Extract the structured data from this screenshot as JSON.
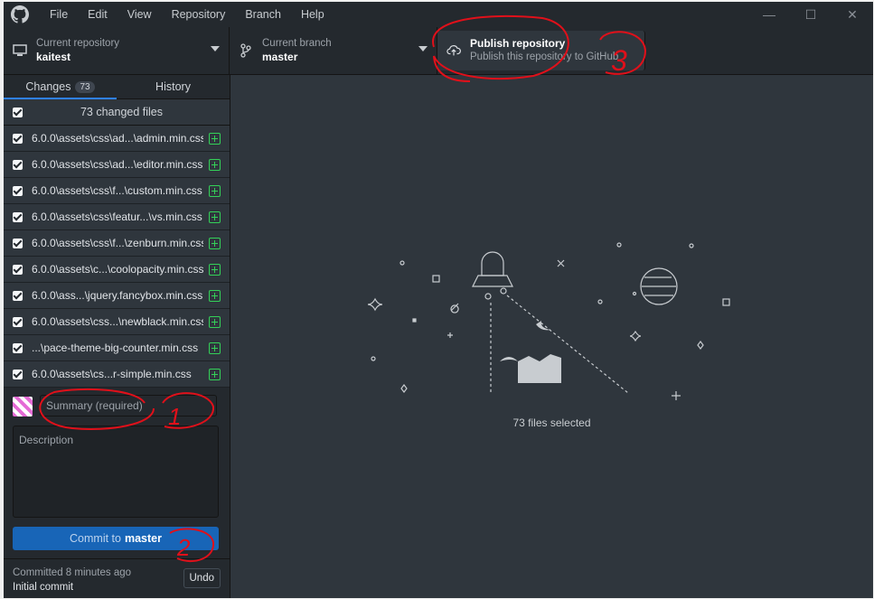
{
  "menu": [
    "File",
    "Edit",
    "View",
    "Repository",
    "Branch",
    "Help"
  ],
  "window_controls": {
    "minimize": "—",
    "maximize": "☐",
    "close": "✕"
  },
  "toolbar": {
    "repo_label": "Current repository",
    "repo_name": "kaitest",
    "branch_label": "Current branch",
    "branch_name": "master",
    "publish_title": "Publish repository",
    "publish_desc": "Publish this repository to GitHub"
  },
  "tabs": {
    "changes": "Changes",
    "changes_count": "73",
    "history": "History"
  },
  "changes_header": "73 changed files",
  "files": [
    "6.0.0\\assets\\css\\ad...\\admin.min.css",
    "6.0.0\\assets\\css\\ad...\\editor.min.css",
    "6.0.0\\assets\\css\\f...\\custom.min.css",
    "6.0.0\\assets\\css\\featur...\\vs.min.css",
    "6.0.0\\assets\\css\\f...\\zenburn.min.css",
    "6.0.0\\assets\\c...\\coolopacity.min.css",
    "6.0.0\\ass...\\jquery.fancybox.min.css",
    "6.0.0\\assets\\css...\\newblack.min.css",
    "...\\pace-theme-big-counter.min.css",
    "6.0.0\\assets\\cs...r-simple.min.css"
  ],
  "commit": {
    "summary_placeholder": "Summary (required)",
    "description_placeholder": "Description",
    "button_prefix": "Commit to",
    "button_branch": "master"
  },
  "last_commit": {
    "when": "Committed 8 minutes ago",
    "message": "Initial commit",
    "undo": "Undo"
  },
  "main": {
    "selected_text": "73 files selected"
  },
  "annotations": [
    "1",
    "2",
    "3"
  ],
  "colors": {
    "accent": "#2f81f7",
    "commit_button": "#1865b7",
    "added": "#34d058",
    "annotation": "#e0101a"
  }
}
